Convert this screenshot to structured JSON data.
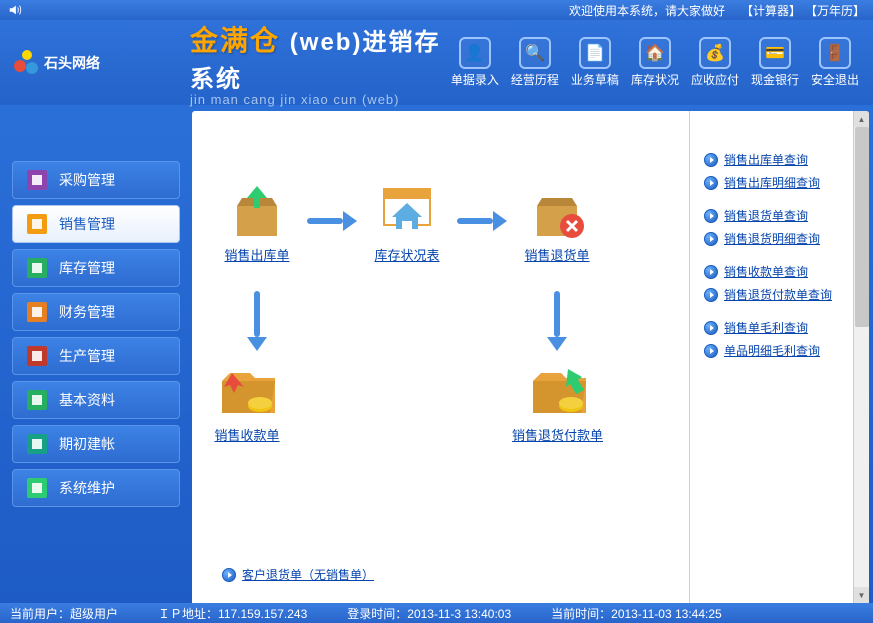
{
  "topbar": {
    "welcome": "欢迎使用本系统，请大家做好",
    "calc": "【计算器】",
    "calendar": "【万年历】"
  },
  "header": {
    "logo_text": "石头网络",
    "title_gold": "金满仓",
    "title_white": "(web)进销存系统",
    "subtitle": "jin man cang jin xiao cun (web)"
  },
  "toolbar": [
    {
      "label": "单据录入",
      "glyph": "👤"
    },
    {
      "label": "经营历程",
      "glyph": "🔍"
    },
    {
      "label": "业务草稿",
      "glyph": "📄"
    },
    {
      "label": "库存状况",
      "glyph": "🏠"
    },
    {
      "label": "应收应付",
      "glyph": "💰"
    },
    {
      "label": "现金银行",
      "glyph": "💳"
    },
    {
      "label": "安全退出",
      "glyph": "🚪"
    }
  ],
  "nav": [
    {
      "label": "采购管理",
      "color": "#8e44ad"
    },
    {
      "label": "销售管理",
      "color": "#f39c12",
      "active": true
    },
    {
      "label": "库存管理",
      "color": "#27ae60"
    },
    {
      "label": "财务管理",
      "color": "#e67e22"
    },
    {
      "label": "生产管理",
      "color": "#c0392b"
    },
    {
      "label": "基本资料",
      "color": "#27ae60"
    },
    {
      "label": "期初建帐",
      "color": "#16a085"
    },
    {
      "label": "系统维护",
      "color": "#2ecc71"
    }
  ],
  "flow": {
    "out": "销售出库单",
    "stock": "库存状况表",
    "return": "销售退货单",
    "receipt": "销售收款单",
    "refund": "销售退货付款单"
  },
  "bottom_link": "客户退货单（无销售单）",
  "queries": [
    [
      "销售出库单查询",
      "销售出库明细查询"
    ],
    [
      "销售退货单查询",
      "销售退货明细查询"
    ],
    [
      "销售收款单查询",
      "销售退货付款单查询"
    ],
    [
      "销售单毛利查询",
      "单品明细毛利查询"
    ]
  ],
  "status": {
    "user_label": "当前用户：",
    "user_value": "超级用户",
    "ip_label": "ＩＰ地址：",
    "ip_value": "117.159.157.243",
    "login_label": "登录时间：",
    "login_value": "2013-11-3 13:40:03",
    "now_label": "当前时间：",
    "now_value": "2013-11-03 13:44:25"
  }
}
